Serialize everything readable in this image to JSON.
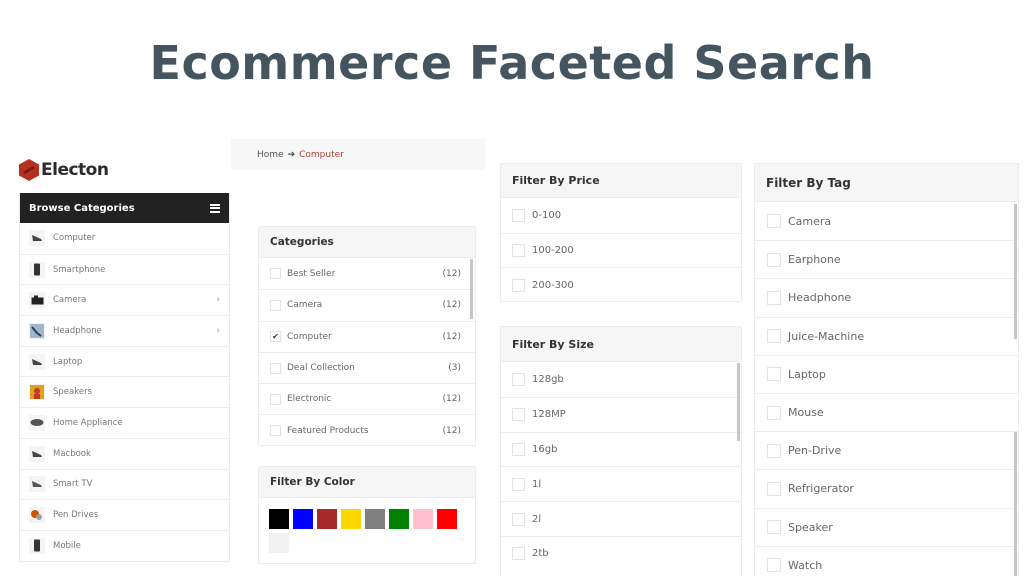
{
  "page": {
    "title": "Ecommerce Faceted Search"
  },
  "logo": {
    "text": "Electon",
    "brand_color": "#b5301f"
  },
  "sidebar": {
    "header": "Browse Categories",
    "menu_icon": "hamburger-icon",
    "items": [
      {
        "label": "Computer",
        "icon": "laptop-icon",
        "has_submenu": false
      },
      {
        "label": "Smartphone",
        "icon": "smartphone-icon",
        "has_submenu": false
      },
      {
        "label": "Camera",
        "icon": "camera-icon",
        "has_submenu": true
      },
      {
        "label": "Headphone",
        "icon": "headphone-icon",
        "has_submenu": true
      },
      {
        "label": "Laptop",
        "icon": "laptop-icon",
        "has_submenu": false
      },
      {
        "label": "Speakers",
        "icon": "speaker-icon",
        "has_submenu": false
      },
      {
        "label": "Home Appliance",
        "icon": "appliance-icon",
        "has_submenu": false
      },
      {
        "label": "Macbook",
        "icon": "laptop-icon",
        "has_submenu": false
      },
      {
        "label": "Smart TV",
        "icon": "tv-icon",
        "has_submenu": false
      },
      {
        "label": "Pen Drives",
        "icon": "pen-drive-icon",
        "has_submenu": false
      },
      {
        "label": "Mobile",
        "icon": "smartphone-icon",
        "has_submenu": false
      }
    ],
    "chevron": "›"
  },
  "breadcrumb": {
    "home": "Home",
    "separator": "➔",
    "current": "Computer",
    "current_color": "#a5453a"
  },
  "categories": {
    "title": "Categories",
    "items": [
      {
        "label": "Best Seller",
        "count": "(12)",
        "checked": false
      },
      {
        "label": "Camera",
        "count": "(12)",
        "checked": false
      },
      {
        "label": "Computer",
        "count": "(12)",
        "checked": true
      },
      {
        "label": "Deal Collection",
        "count": "(3)",
        "checked": false
      },
      {
        "label": "Electronic",
        "count": "(12)",
        "checked": false
      },
      {
        "label": "Featured Products",
        "count": "(12)",
        "checked": false
      }
    ]
  },
  "color_filter": {
    "title": "Filter By Color",
    "swatches": [
      {
        "name": "black",
        "hex": "#000000"
      },
      {
        "name": "blue",
        "hex": "#0000ff"
      },
      {
        "name": "brown",
        "hex": "#a52a2a"
      },
      {
        "name": "gold",
        "hex": "#ffd700"
      },
      {
        "name": "gray",
        "hex": "#808080"
      },
      {
        "name": "green",
        "hex": "#008000"
      },
      {
        "name": "pink",
        "hex": "#ffc0cb"
      },
      {
        "name": "red",
        "hex": "#ff0000"
      },
      {
        "name": "whitesmoke",
        "hex": "#f2f2f2"
      }
    ]
  },
  "price_filter": {
    "title": "Filter By Price",
    "items": [
      {
        "label": "0-100",
        "checked": false
      },
      {
        "label": "100-200",
        "checked": false
      },
      {
        "label": "200-300",
        "checked": false
      }
    ]
  },
  "size_filter": {
    "title": "Filter By Size",
    "items": [
      {
        "label": "128gb",
        "checked": false
      },
      {
        "label": "128MP",
        "checked": false
      },
      {
        "label": "16gb",
        "checked": false
      },
      {
        "label": "1l",
        "checked": false
      },
      {
        "label": "2l",
        "checked": false
      },
      {
        "label": "2tb",
        "checked": false
      }
    ]
  },
  "tag_filter": {
    "title": "Filter By Tag",
    "items": [
      {
        "label": "Camera",
        "checked": false
      },
      {
        "label": "Earphone",
        "checked": false
      },
      {
        "label": "Headphone",
        "checked": false
      },
      {
        "label": "Juice-Machine",
        "checked": false
      },
      {
        "label": "Laptop",
        "checked": false
      },
      {
        "label": "Mouse",
        "checked": false
      },
      {
        "label": "Pen-Drive",
        "checked": false
      },
      {
        "label": "Refrigerator",
        "checked": false
      },
      {
        "label": "Speaker",
        "checked": false
      },
      {
        "label": "Watch",
        "checked": false
      }
    ]
  }
}
